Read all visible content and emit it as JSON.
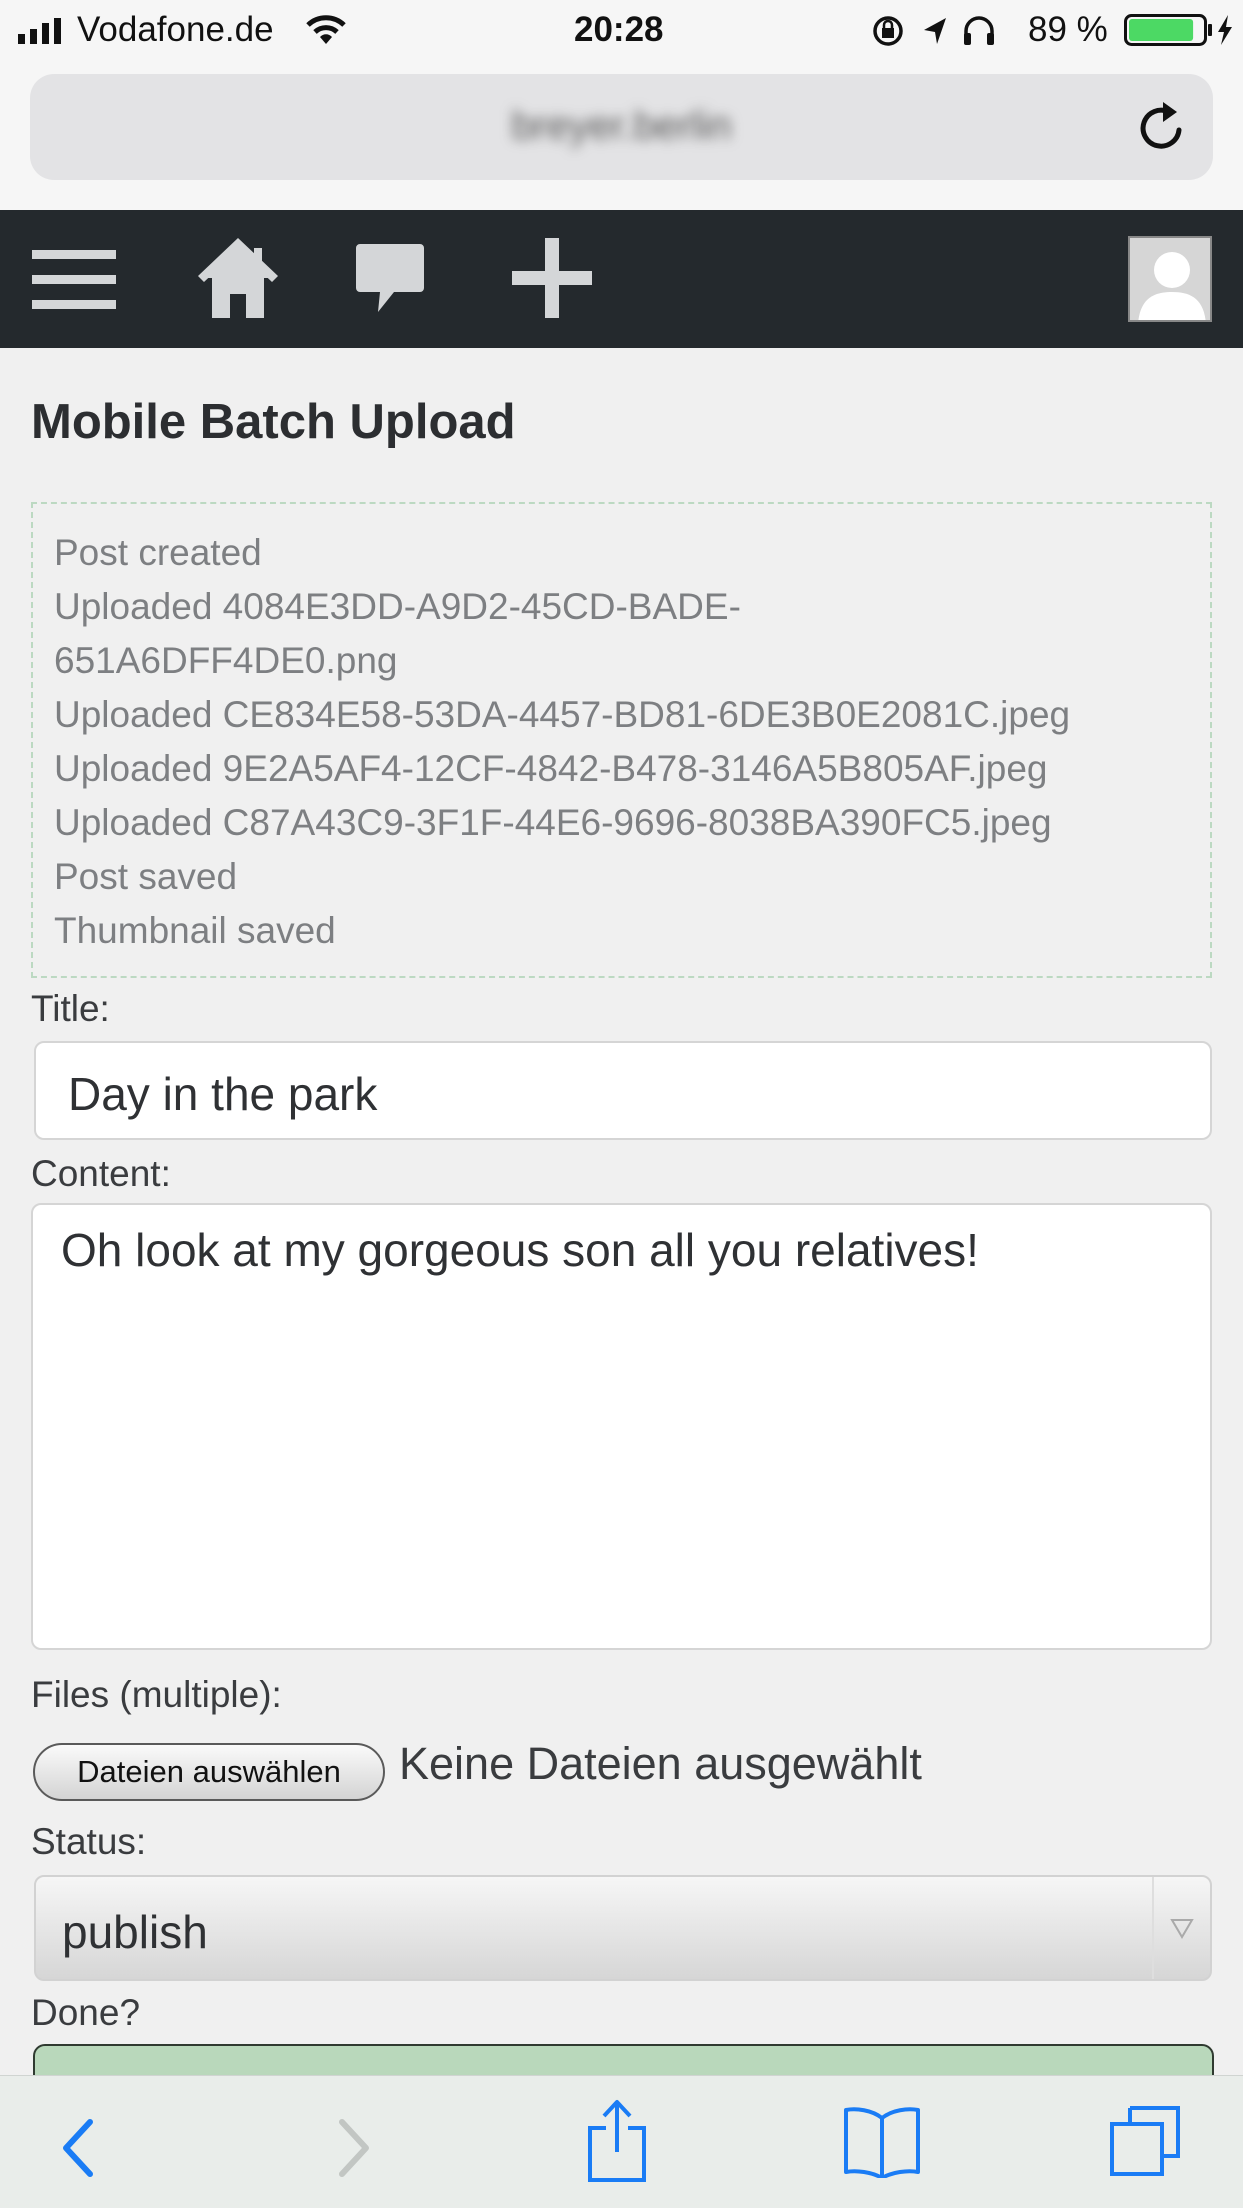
{
  "status_bar": {
    "carrier": "Vodafone.de",
    "time": "20:28",
    "battery_percent": "89 %",
    "battery_level": 0.89
  },
  "browser": {
    "url": "breyer.berlin"
  },
  "colors": {
    "nav_bg": "#24292d",
    "done_button": "#b9d8bb",
    "log_border": "#bcd9c2",
    "toolbar_accent": "#1a7cf5",
    "battery_green": "#4cd964"
  },
  "nav": {
    "icons": [
      "menu-icon",
      "home-icon",
      "comment-icon",
      "plus-icon"
    ],
    "avatar_icon": "user-avatar-icon"
  },
  "main": {
    "title": "Mobile Batch Upload",
    "log": [
      "Post created",
      "Uploaded 4084E3DD-A9D2-45CD-BADE-",
      "651A6DFF4DE0.png",
      "Uploaded CE834E58-53DA-4457-BD81-6DE3B0E2081C.jpeg",
      "Uploaded 9E2A5AF4-12CF-4842-B478-3146A5B805AF.jpeg",
      "Uploaded C87A43C9-3F1F-44E6-9696-8038BA390FC5.jpeg",
      "Post saved",
      "Thumbnail saved"
    ],
    "title_label": "Title:",
    "title_value": "Day in the park",
    "content_label": "Content:",
    "content_value": "Oh look at my gorgeous son all you relatives!",
    "files_label": "Files (multiple):",
    "files_button": "Dateien auswählen",
    "files_status": "Keine Dateien ausgewählt",
    "status_label": "Status:",
    "status_value": "publish",
    "done_label": "Done?"
  },
  "toolbar": {
    "icons": [
      "back-icon",
      "forward-icon",
      "share-icon",
      "bookmarks-icon",
      "tabs-icon"
    ]
  }
}
